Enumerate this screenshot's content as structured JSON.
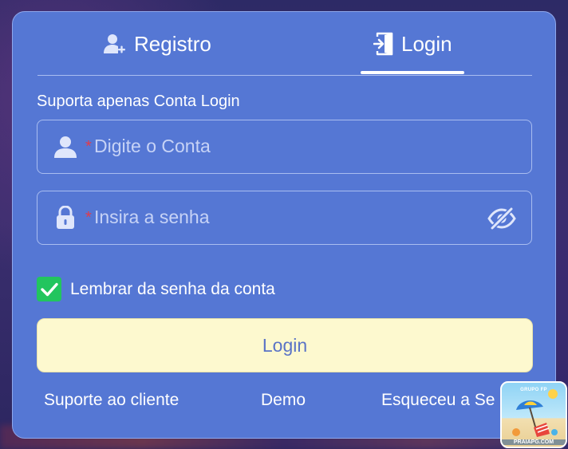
{
  "tabs": {
    "register_label": "Registro",
    "login_label": "Login",
    "active": "login"
  },
  "form": {
    "hint": "Suporta apenas Conta Login",
    "account": {
      "required_mark": "*",
      "placeholder": "Digite o Conta",
      "value": ""
    },
    "password": {
      "required_mark": "*",
      "placeholder": "Insira a senha",
      "value": ""
    },
    "remember": {
      "label": "Lembrar da senha da conta",
      "checked": true
    },
    "submit_label": "Login"
  },
  "footer": {
    "support_label": "Suporte ao cliente",
    "demo_label": "Demo",
    "forgot_label": "Esqueceu a Se"
  },
  "badge": {
    "top_text": "GRUPO FP",
    "bottom_text": "PRAIAPG.COM"
  },
  "colors": {
    "modal_bg": "#5577d4",
    "button_bg": "#fdf9cf",
    "checkbox": "#22c55e",
    "required": "#e23b4b"
  },
  "icons": {
    "register_tab": "user-plus-icon",
    "login_tab": "door-enter-icon",
    "account_field": "user-icon",
    "password_field": "lock-icon",
    "password_toggle": "eye-off-icon",
    "checkbox": "check-icon"
  }
}
